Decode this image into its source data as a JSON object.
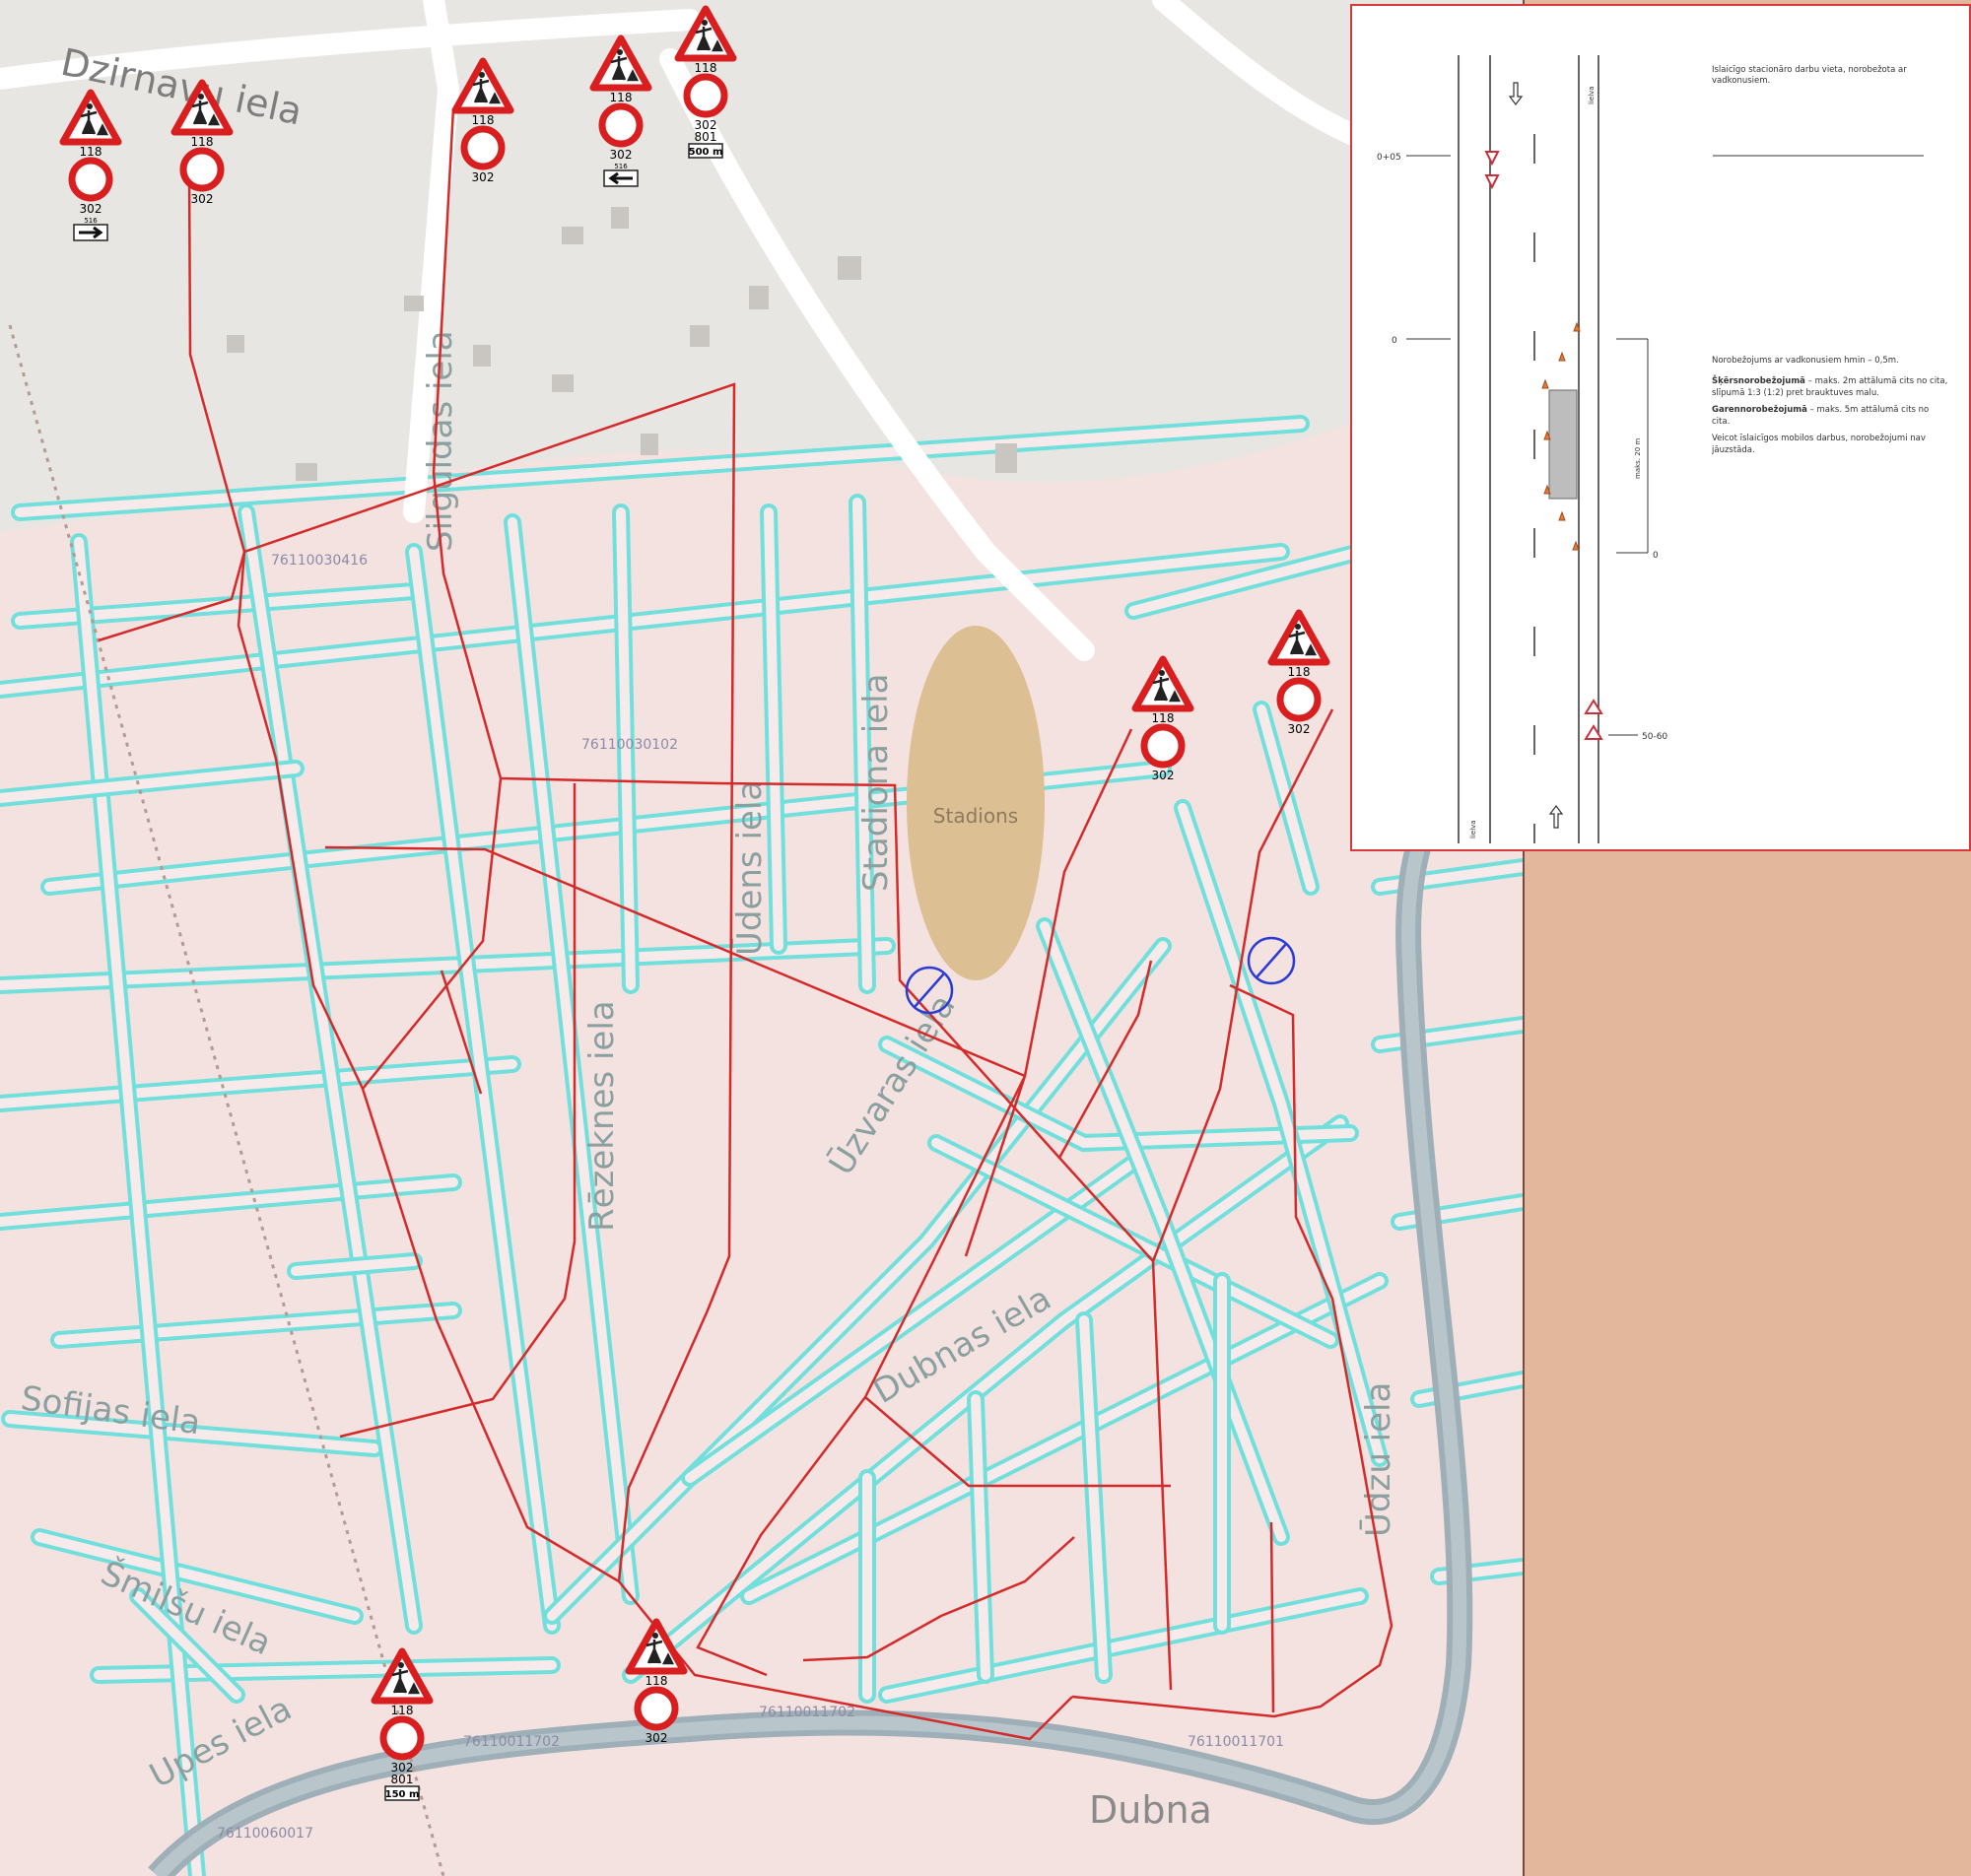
{
  "streets": [
    "Dzirnavu iela",
    "Silguldas iela",
    "Stadiona iela",
    "Ūdens iela",
    "Rēzeknes iela",
    "Šmilšu iela",
    "Upes iela",
    "Sofijas iela",
    "Dubnas iela",
    "Ūzvaras iela",
    "Ūdzu iela"
  ],
  "river": "Dubna",
  "stadium": "Stadions",
  "parcels": [
    "76110030416",
    "76110030102",
    "76110011702",
    "76110011702",
    "76110011701",
    "76110060017"
  ],
  "signs": {
    "warning_code": "118",
    "prohibition_code": "302",
    "plate_code": "801",
    "plate_500": "500 m",
    "plate_150": "150 m",
    "arrow_code": "516"
  },
  "inset": {
    "chainage_top": "0+05",
    "chainage_mid": "0",
    "chainage_low": "0",
    "chainage_bottom": "50-60",
    "lane_left": "lielva",
    "lane_right": "lielva",
    "max_length": "maks. 20 m",
    "legend_title": "Īslaicīgo stacionāro darbu vieta, norobežota ar vadkonusiem.",
    "note1": "Norobežojums ar vadkonusiem hmin – 0,5m.",
    "note2_bold": "Šķērsnorobežojumā",
    "note2": " – maks. 2m attālumā cits no cita, slīpumā 1:3 (1:2) pret brauktuves malu.",
    "note3_bold": "Garennorobežojumā",
    "note3": " – maks. 5m attālumā cits no cita.",
    "note4": "Veicot īslaicīgos mobilos darbus, norobežojumi nav jāuzstāda."
  },
  "colors": {
    "route": "#d42a2a",
    "road": "#71e0dc",
    "sign_red": "#d81e1e",
    "no_parking": "#2a3bd6"
  }
}
